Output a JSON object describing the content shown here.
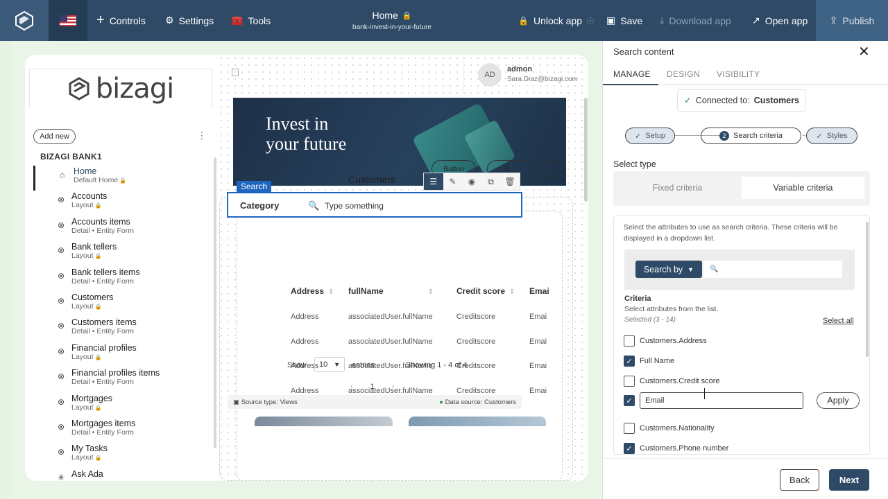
{
  "topbar": {
    "flag": "US",
    "controls": "Controls",
    "settings": "Settings",
    "tools": "Tools",
    "page_title": "Home",
    "page_slug": "bank-invest-in-your-future",
    "unlock": "Unlock app",
    "save": "Save",
    "download": "Download app",
    "open": "Open app",
    "publish": "Publish",
    "colors": {
      "bar": "#2e4a66",
      "accent": "#1f66c1"
    }
  },
  "sidebar": {
    "logo": "bizagi",
    "add_new": "Add new",
    "bank_title": "BIZAGI BANK1",
    "items": [
      {
        "label": "Home",
        "sub": "Default Home",
        "icon": "home-icon"
      },
      {
        "label": "Accounts",
        "sub": "Layout",
        "icon": "link-icon"
      },
      {
        "label": "Accounts items",
        "sub": "Detail • Entity Form",
        "icon": "link-icon"
      },
      {
        "label": "Bank tellers",
        "sub": "Layout",
        "icon": "link-icon"
      },
      {
        "label": "Bank tellers items",
        "sub": "Detail • Entity Form",
        "icon": "link-icon"
      },
      {
        "label": "Customers",
        "sub": "Layout",
        "icon": "link-icon"
      },
      {
        "label": "Customers items",
        "sub": "Detail • Entity Form",
        "icon": "link-icon"
      },
      {
        "label": "Financial profiles",
        "sub": "Layout",
        "icon": "link-icon"
      },
      {
        "label": "Financial profiles items",
        "sub": "Detail • Entity Form",
        "icon": "link-icon"
      },
      {
        "label": "Mortgages",
        "sub": "Layout",
        "icon": "link-icon"
      },
      {
        "label": "Mortgages items",
        "sub": "Detail • Entity Form",
        "icon": "link-icon"
      },
      {
        "label": "My Tasks",
        "sub": "Layout",
        "icon": "link-icon"
      },
      {
        "label": "Ask Ada",
        "sub": "",
        "icon": "sparkle-icon"
      }
    ]
  },
  "user": {
    "initials": "AD",
    "name": "admon",
    "email": "Sara.Diaz@bizagi.com"
  },
  "banner": {
    "line1": "Invest in",
    "line2": "your future",
    "button1": "Button",
    "button2": "B..."
  },
  "component": {
    "tag": "Search",
    "title": "Customers",
    "category": "Category",
    "search_placeholder": "Type something",
    "columns": [
      "Address",
      "fullName",
      "Credit score",
      "Emai"
    ],
    "rows": [
      [
        "Address",
        "associatedUser.fullName",
        "Creditscore",
        "Emai"
      ],
      [
        "Address",
        "associatedUser.fullName",
        "Creditscore",
        "Emai"
      ],
      [
        "Address",
        "associatedUser.fullName",
        "Creditscore",
        "Emai"
      ],
      [
        "Address",
        "associatedUser.fullName",
        "Creditscore",
        "Emai"
      ]
    ],
    "show": "Show",
    "page_size": "10",
    "entries": "entries",
    "showing": "Showing 1 - 4 of 4",
    "page": "1",
    "source_type": "Source type: Views",
    "data_source": "Data source: Customers"
  },
  "panel": {
    "title": "Search content",
    "tabs": [
      "MANAGE",
      "DESIGN",
      "VISIBILITY"
    ],
    "connected_prefix": "Connected to:",
    "connected_entity": "Customers",
    "steps": [
      {
        "label": "Setup",
        "state": "done"
      },
      {
        "label": "Search criteria",
        "state": "current",
        "num": "2"
      },
      {
        "label": "Styles",
        "state": "done"
      }
    ],
    "select_type": "Select type",
    "fixed": "Fixed criteria",
    "variable": "Variable criteria",
    "description": "Select the attributes to use as search criteria. These criteria will be displayed in a dropdown list.",
    "search_by": "Search by",
    "criteria_title": "Criteria",
    "criteria_sub": "Select attributes from the list.",
    "selected": "Selected (3 - 14)",
    "select_all": "Select all",
    "criteria": [
      {
        "label": "Customers.Address",
        "checked": false
      },
      {
        "label": "Full Name",
        "checked": true
      },
      {
        "label": "Customers.Credit score",
        "checked": false
      },
      {
        "label": "Email",
        "checked": true,
        "editing": true
      },
      {
        "label": "Customers.Nationality",
        "checked": false
      },
      {
        "label": "Customers.Phone number",
        "checked": true
      }
    ],
    "apply": "Apply",
    "back": "Back",
    "next": "Next"
  }
}
